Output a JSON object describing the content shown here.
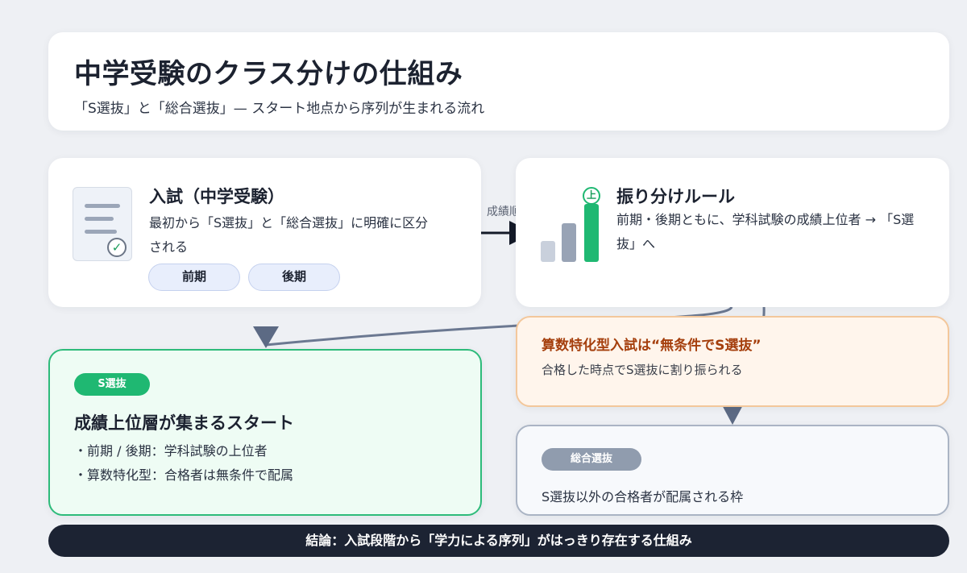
{
  "header": {
    "title": "中学受験のクラス分けの仕組み",
    "subtitle": "「S選抜」と「総合選抜」— スタート地点から序列が生まれる流れ"
  },
  "exam": {
    "title": "入試（中学受験）",
    "desc": "最初から「S選抜」と「総合選抜」に明確に区分される",
    "pills": [
      "前期",
      "後期"
    ]
  },
  "arrow_label": "成績順",
  "rule": {
    "title": "振り分けルール",
    "desc": "前期・後期ともに、学科試験の成績上位者 → 「S選抜」へ",
    "badge": "上"
  },
  "s_class": {
    "tag": "S選抜",
    "title": "成績上位層が集まるスタート",
    "bullets": [
      "・前期 / 後期：学科試験の上位者",
      "・算数特化型：合格者は無条件で配属"
    ]
  },
  "math_special": {
    "title": "算数特化型入試は“無条件でS選抜”",
    "desc": "合格した時点でS選抜に割り振られる"
  },
  "general_class": {
    "tag": "総合選抜",
    "desc": "S選抜以外の合格者が配属される枠"
  },
  "conclusion": "結論：入試段階から「学力による序列」がはっきり存在する仕組み",
  "colors": {
    "accent_green": "#1fb872",
    "accent_orange": "#a53f0d",
    "dark": "#1c2333",
    "slate": "#909cae"
  },
  "icons": [
    "document-check-icon",
    "rising-bars-icon",
    "arrow-right-icon",
    "arrow-down-icon"
  ]
}
